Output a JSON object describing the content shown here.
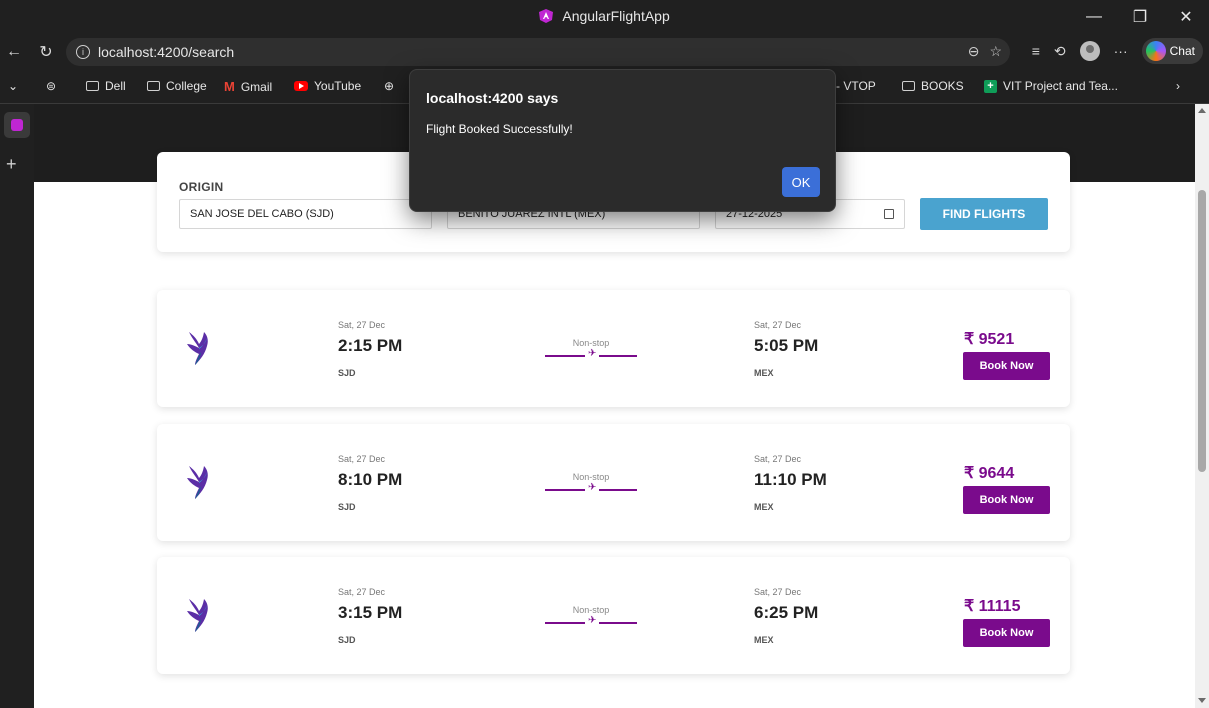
{
  "window": {
    "title": "AngularFlightApp",
    "minimize": "—",
    "restore": "❐",
    "close": "✕"
  },
  "browser": {
    "url": "localhost:4200/search",
    "chat_label": "Chat"
  },
  "bookmarks": [
    "Dell",
    "College",
    "Gmail",
    "YouTube",
    "e - VTOP",
    "BOOKS",
    "VIT Project and Tea..."
  ],
  "search": {
    "origin_label": "ORIGIN",
    "origin_value": "SAN JOSE DEL CABO (SJD)",
    "destination_value": "BENITO JUAREZ INTL (MEX)",
    "date_value": "27-12-2025",
    "find_button": "FIND FLIGHTS"
  },
  "flights": [
    {
      "dep_date": "Sat, 27 Dec",
      "dep_time": "2:15 PM",
      "dep_code": "SJD",
      "stops": "Non-stop",
      "arr_date": "Sat, 27 Dec",
      "arr_time": "5:05 PM",
      "arr_code": "MEX",
      "price": "₹ 9521",
      "book_label": "Book Now"
    },
    {
      "dep_date": "Sat, 27 Dec",
      "dep_time": "8:10 PM",
      "dep_code": "SJD",
      "stops": "Non-stop",
      "arr_date": "Sat, 27 Dec",
      "arr_time": "11:10 PM",
      "arr_code": "MEX",
      "price": "₹ 9644",
      "book_label": "Book Now"
    },
    {
      "dep_date": "Sat, 27 Dec",
      "dep_time": "3:15 PM",
      "dep_code": "SJD",
      "stops": "Non-stop",
      "arr_date": "Sat, 27 Dec",
      "arr_time": "6:25 PM",
      "arr_code": "MEX",
      "price": "₹ 11115",
      "book_label": "Book Now"
    }
  ],
  "alert": {
    "title": "localhost:4200 says",
    "message": "Flight Booked Successfully!",
    "ok_label": "OK"
  },
  "colors": {
    "accent": "#7a0b8c",
    "find_button": "#4aa3cf",
    "alert_ok": "#3b6fd8"
  }
}
